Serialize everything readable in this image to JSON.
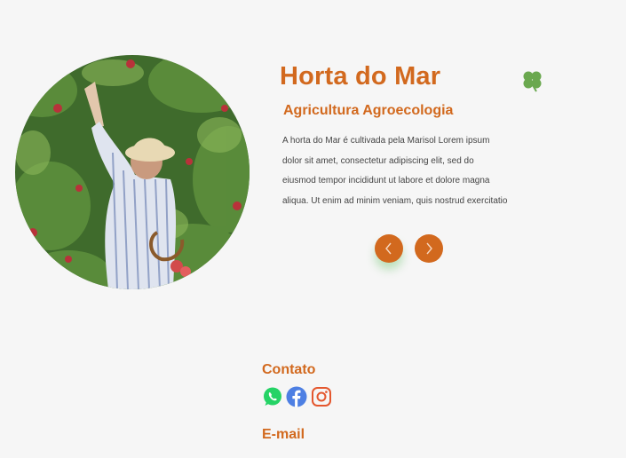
{
  "hero": {
    "title": "Horta do Mar",
    "subtitle": "Agricultura Agroecologia",
    "description": "A horta do Mar é  cultivada pela Marisol Lorem ipsum\ndolor sit amet, consectetur adipiscing elit, sed do\neiusmod tempor incididunt ut labore et dolore magna\naliqua. Ut enim ad minim veniam, quis nostrud exercitatio",
    "image_icon": "woman-picking-apples-photo",
    "decoration_icon": "four-leaf-clover-icon"
  },
  "carousel": {
    "prev_icon": "chevron-left-icon",
    "next_icon": "chevron-right-icon"
  },
  "contact": {
    "label": "Contato",
    "social": [
      {
        "name": "whatsapp-icon",
        "color": "#25d366"
      },
      {
        "name": "facebook-icon",
        "color": "#4d7fe3"
      },
      {
        "name": "instagram-icon",
        "color": "#e4572e"
      }
    ]
  },
  "email": {
    "label": "E-mail"
  },
  "colors": {
    "accent": "#d2691e",
    "background": "#f6f6f6",
    "clover": "#6aa84f"
  }
}
